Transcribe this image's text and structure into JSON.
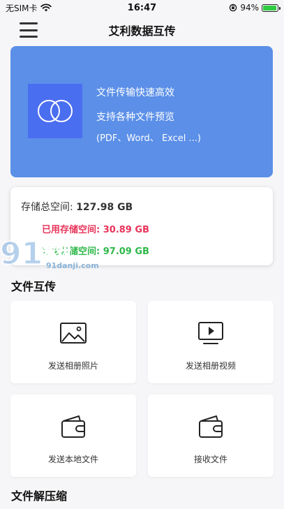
{
  "status_bar": {
    "carrier": "无SIM卡",
    "time": "16:47",
    "battery": "94%",
    "battery_level": 0.94
  },
  "header": {
    "title": "艾利数据互传"
  },
  "banner": {
    "line1": "文件传输快速高效",
    "line2": "支持各种文件预览",
    "line3": "(PDF、Word、 Excel ...)",
    "bg_color": "#5b8fe8"
  },
  "storage": {
    "total_label": "存储总空间: ",
    "total_value": "127.98 GB",
    "used_label": "已用存储空间: ",
    "used_value": "30.89 GB",
    "free_label": "可用存储空间: ",
    "free_value": "97.09 GB",
    "used_color": "#e8345a",
    "free_color": "#2fb84a"
  },
  "watermark": {
    "logo": "91游戏",
    "site": "91danji.com"
  },
  "sections": {
    "transfer_title": "文件互传",
    "compress_title": "文件解压缩"
  },
  "tiles": [
    {
      "label": "发送相册照片",
      "icon": "photo-icon"
    },
    {
      "label": "发送相册视频",
      "icon": "video-icon"
    },
    {
      "label": "发送本地文件",
      "icon": "wallet-icon"
    },
    {
      "label": "接收文件",
      "icon": "wallet-icon"
    }
  ]
}
